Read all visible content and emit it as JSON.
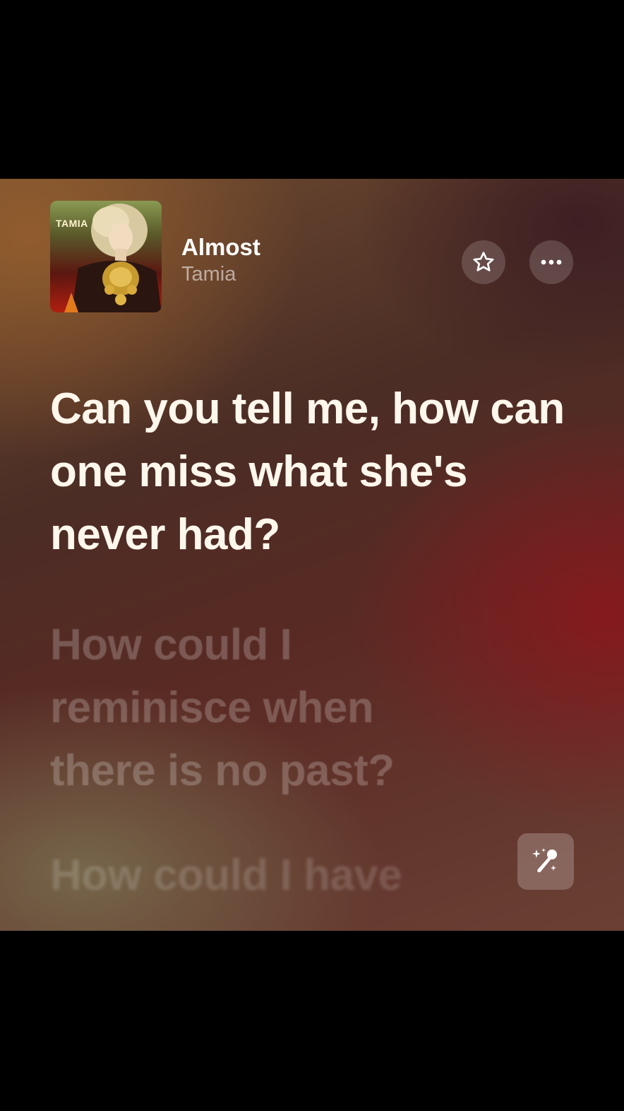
{
  "now_playing": {
    "artwork_label": "TAMIA",
    "title": "Almost",
    "artist": "Tamia"
  },
  "actions": {
    "favorite_icon": "star-outline-icon",
    "more_icon": "ellipsis-icon",
    "sing_icon": "microphone-sparkles-icon"
  },
  "lyrics": {
    "active_line": "Can you tell me, how can one miss what she's never had?",
    "next_line": "How could I reminisce when there is no past?",
    "following_line": "How could I have"
  },
  "colors": {
    "active_text": "#fff7ec",
    "inactive_text": "rgba(255,255,255,0.22)",
    "background_dark_red": "#8c161c",
    "background_brown": "#6d4a30"
  }
}
